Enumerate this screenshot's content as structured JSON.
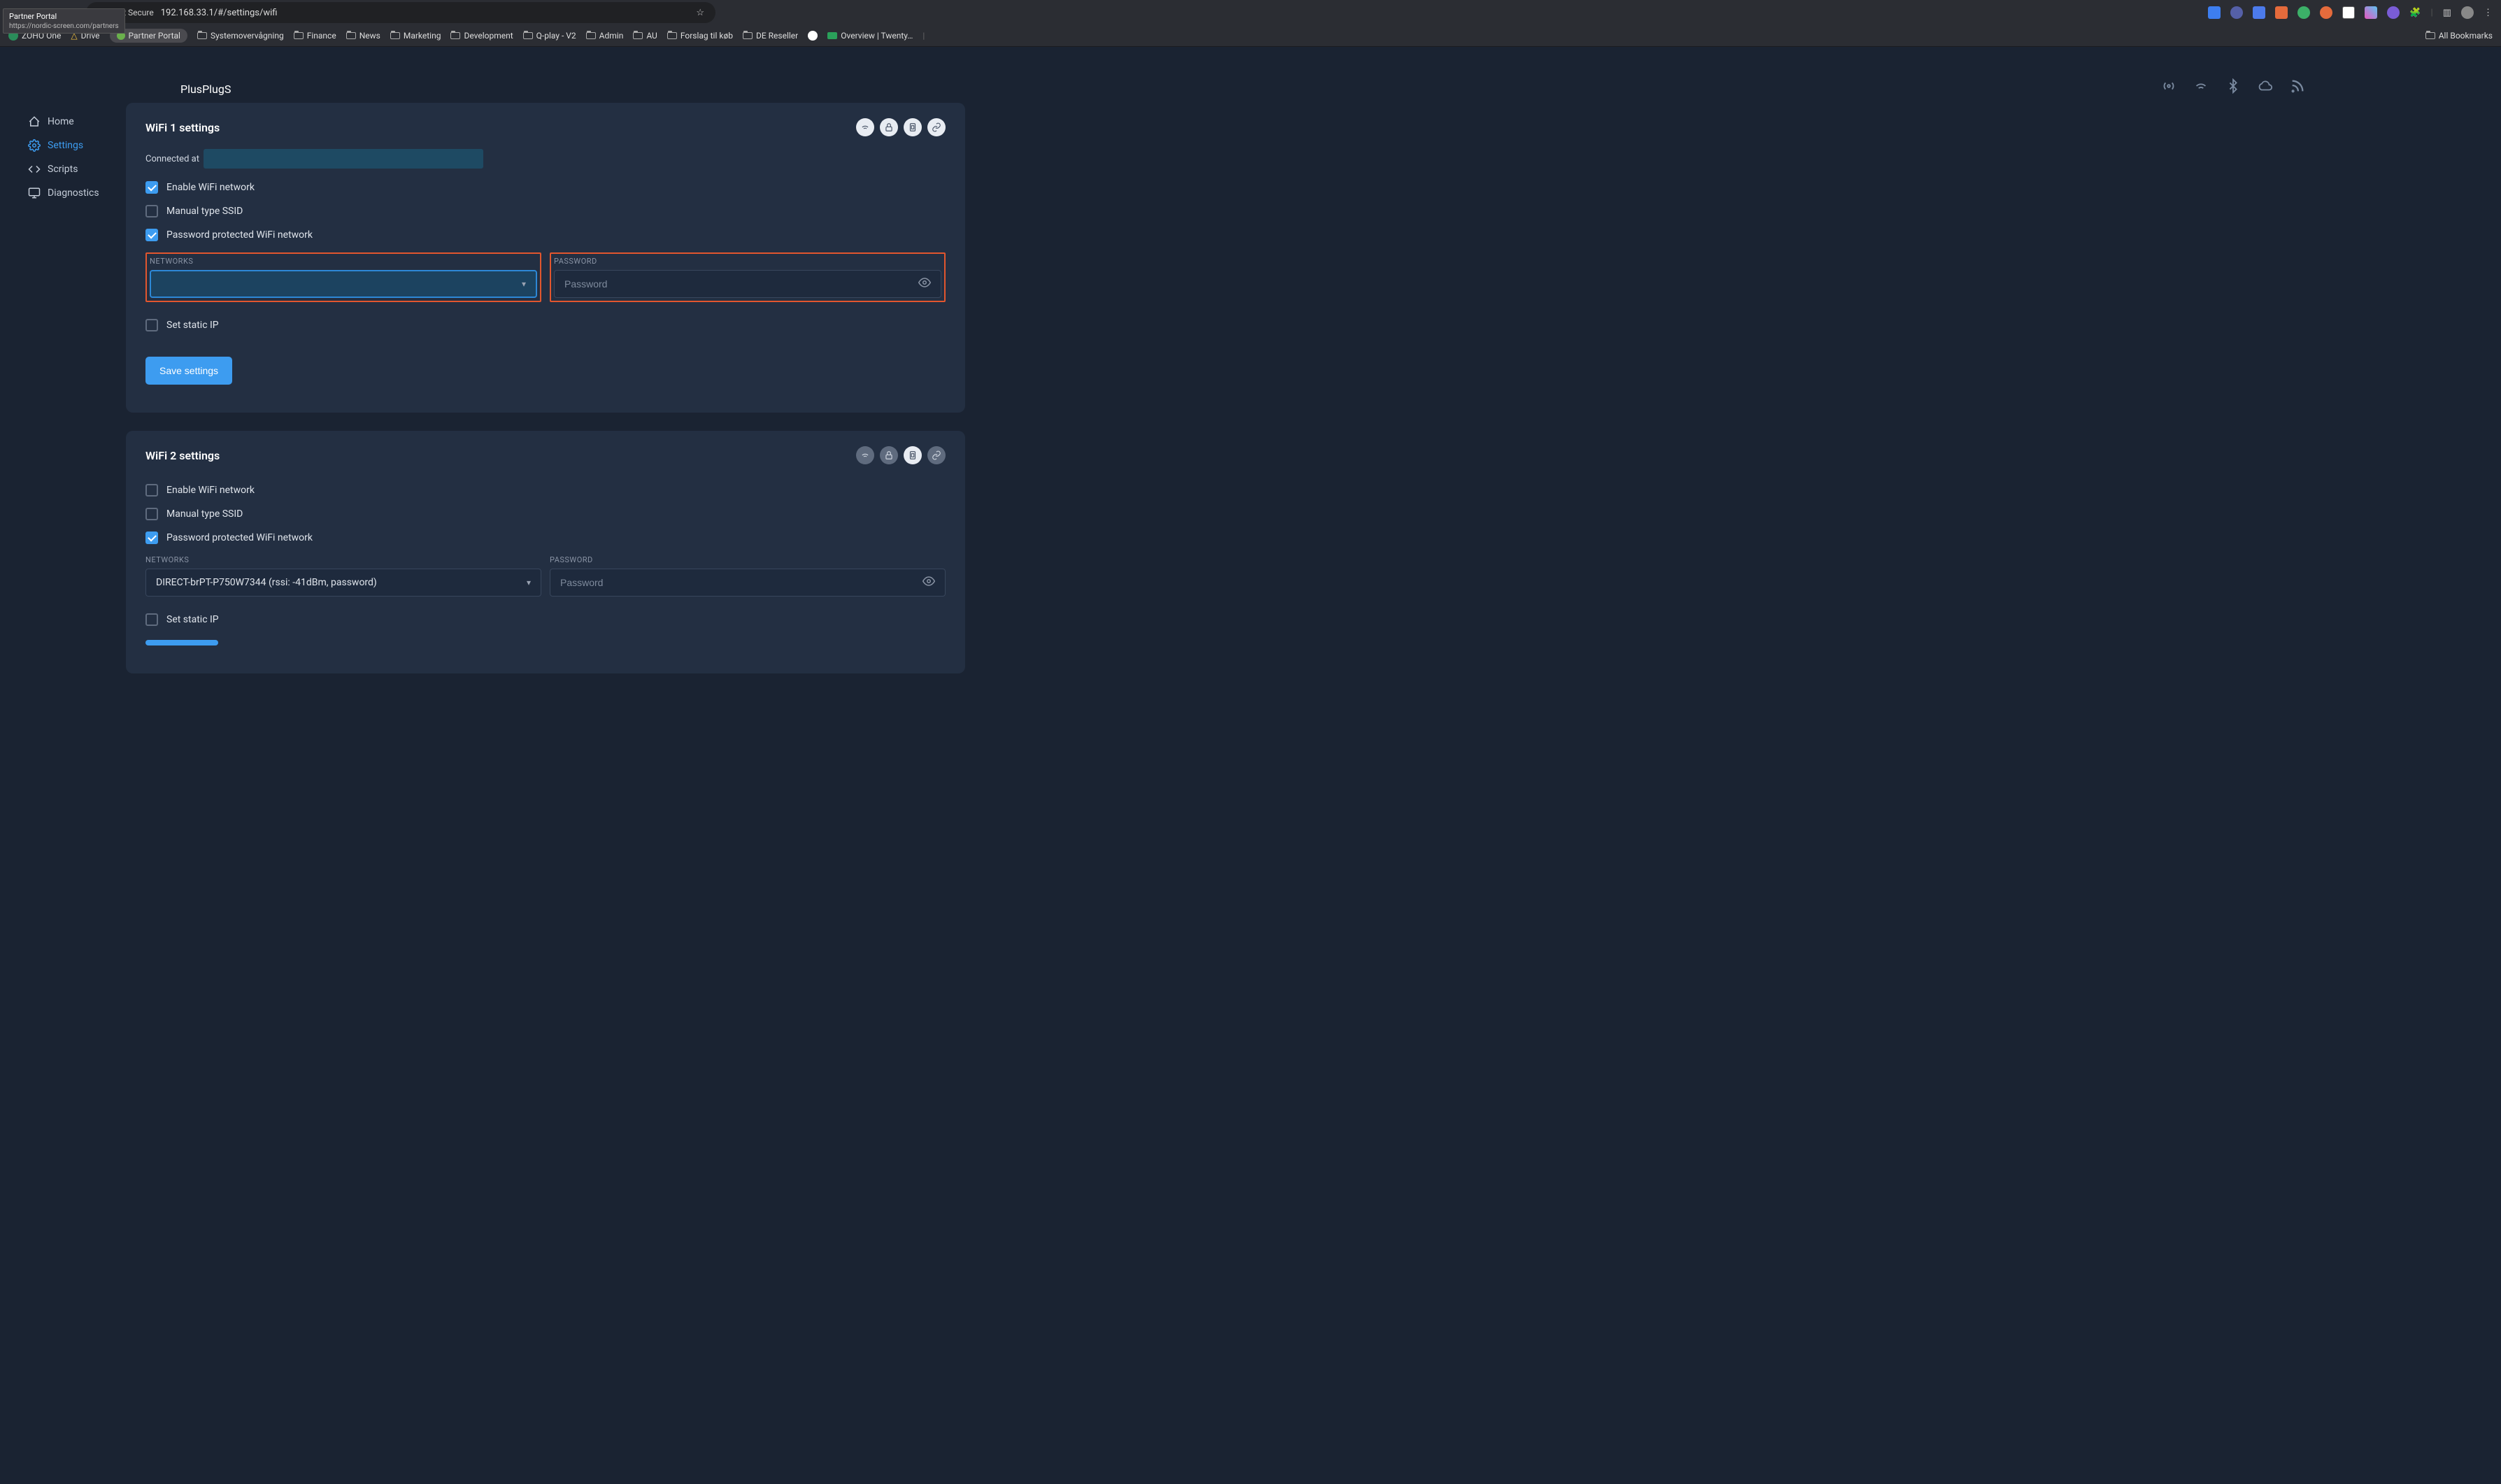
{
  "browser": {
    "tooltip_title": "Partner Portal",
    "tooltip_url": "https://nordic-screen.com/partners",
    "not_secure": "Not Secure",
    "url": "192.168.33.1/#/settings/wifi",
    "bookmarks": [
      {
        "label": "ZOHO One",
        "type": "icon"
      },
      {
        "label": "Drive",
        "type": "drive"
      },
      {
        "label": "Partner Portal",
        "type": "pill"
      },
      {
        "label": "Systemovervågning",
        "type": "folder"
      },
      {
        "label": "Finance",
        "type": "folder"
      },
      {
        "label": "News",
        "type": "folder"
      },
      {
        "label": "Marketing",
        "type": "folder"
      },
      {
        "label": "Development",
        "type": "folder"
      },
      {
        "label": "Q-play - V2",
        "type": "folder"
      },
      {
        "label": "Admin",
        "type": "folder"
      },
      {
        "label": "AU",
        "type": "folder"
      },
      {
        "label": "Forslag til køb",
        "type": "folder"
      },
      {
        "label": "DE Reseller",
        "type": "folder"
      },
      {
        "label": "",
        "type": "misc1"
      },
      {
        "label": "Overview | Twenty…",
        "type": "misc2"
      }
    ],
    "all_bookmarks": "All Bookmarks"
  },
  "app": {
    "brand": "PlusPlugS",
    "sidebar": [
      {
        "label": "Home",
        "icon": "home"
      },
      {
        "label": "Settings",
        "icon": "settings",
        "active": true
      },
      {
        "label": "Scripts",
        "icon": "code"
      },
      {
        "label": "Diagnostics",
        "icon": "monitor"
      }
    ]
  },
  "wifi1": {
    "title": "WiFi 1 settings",
    "connected_at": "Connected at",
    "enable_label": "Enable WiFi network",
    "enable_checked": true,
    "manual_label": "Manual type SSID",
    "manual_checked": false,
    "pwd_protected_label": "Password protected WiFi network",
    "pwd_protected_checked": true,
    "networks_label": "NETWORKS",
    "network_value": "",
    "password_label": "PASSWORD",
    "password_placeholder": "Password",
    "static_ip_label": "Set static IP",
    "static_ip_checked": false,
    "save_label": "Save settings"
  },
  "wifi2": {
    "title": "WiFi 2 settings",
    "enable_label": "Enable WiFi network",
    "enable_checked": false,
    "manual_label": "Manual type SSID",
    "manual_checked": false,
    "pwd_protected_label": "Password protected WiFi network",
    "pwd_protected_checked": true,
    "networks_label": "NETWORKS",
    "network_value": "DIRECT-brPT-P750W7344 (rssi: -41dBm, password)",
    "password_label": "PASSWORD",
    "password_placeholder": "Password",
    "static_ip_label": "Set static IP",
    "static_ip_checked": false
  }
}
